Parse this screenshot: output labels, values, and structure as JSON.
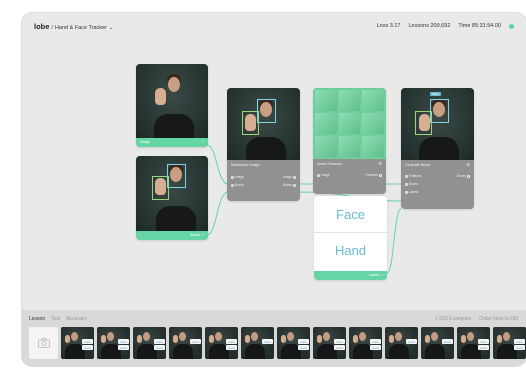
{
  "app": {
    "logo": "lobe",
    "separator": "/",
    "project_name": "Hand & Face Tracker",
    "dropdown_caret": "⌄"
  },
  "stats": {
    "loss": "Loss 3.17",
    "lessons": "Lessons 209,692",
    "time": "Time 85:31:54.00",
    "status_color": "#5cd6a4"
  },
  "nodes": {
    "image_input": {
      "label": "Image",
      "icon": "plus-icon"
    },
    "boxes_input": {
      "label": "Boxes",
      "icon": "plus-icon"
    },
    "randomize": {
      "title": "Randomize Image",
      "ports_in": [
        "Image",
        "Boxes"
      ],
      "ports_out": [
        "Image",
        "Boxes"
      ]
    },
    "detect": {
      "title": "Detect Features",
      "port_in": "Image",
      "port_out": "Features"
    },
    "generate": {
      "title": "Generate Boxes",
      "ports_in": [
        "Features",
        "Boxes",
        "Labels"
      ],
      "port_out": "Boxes",
      "tag": "Face"
    },
    "labels": {
      "items": [
        "Face",
        "Hand"
      ],
      "footer": "Labels"
    }
  },
  "bottom": {
    "tabs": [
      "Lesson",
      "Test",
      "Accuracy"
    ],
    "active_tab": "Lesson",
    "examples": "1,616 Examples",
    "sort": "Order New to Old",
    "thumbnails": [
      {
        "tags": [
          "Face",
          "Hand"
        ]
      },
      {
        "tags": [
          "Face",
          "Hand"
        ]
      },
      {
        "tags": [
          "Face",
          "Hand"
        ]
      },
      {
        "tags": [
          "Hand"
        ]
      },
      {
        "tags": [
          "Face",
          "Hand"
        ]
      },
      {
        "tags": [
          "Face"
        ]
      },
      {
        "tags": [
          "Face",
          "Hand"
        ]
      },
      {
        "tags": [
          "Face",
          "Hand"
        ]
      },
      {
        "tags": [
          "Face",
          "Hand"
        ]
      },
      {
        "tags": [
          "Hand"
        ]
      },
      {
        "tags": [
          "Hand"
        ]
      },
      {
        "tags": [
          "Face",
          "Hand"
        ]
      },
      {
        "tags": [
          "Face",
          "Hand"
        ]
      },
      {
        "tags": [
          "Face"
        ]
      }
    ]
  },
  "colors": {
    "accent_green": "#65d5a6",
    "label_blue": "#6bb9d3",
    "node_gray": "#919191"
  }
}
